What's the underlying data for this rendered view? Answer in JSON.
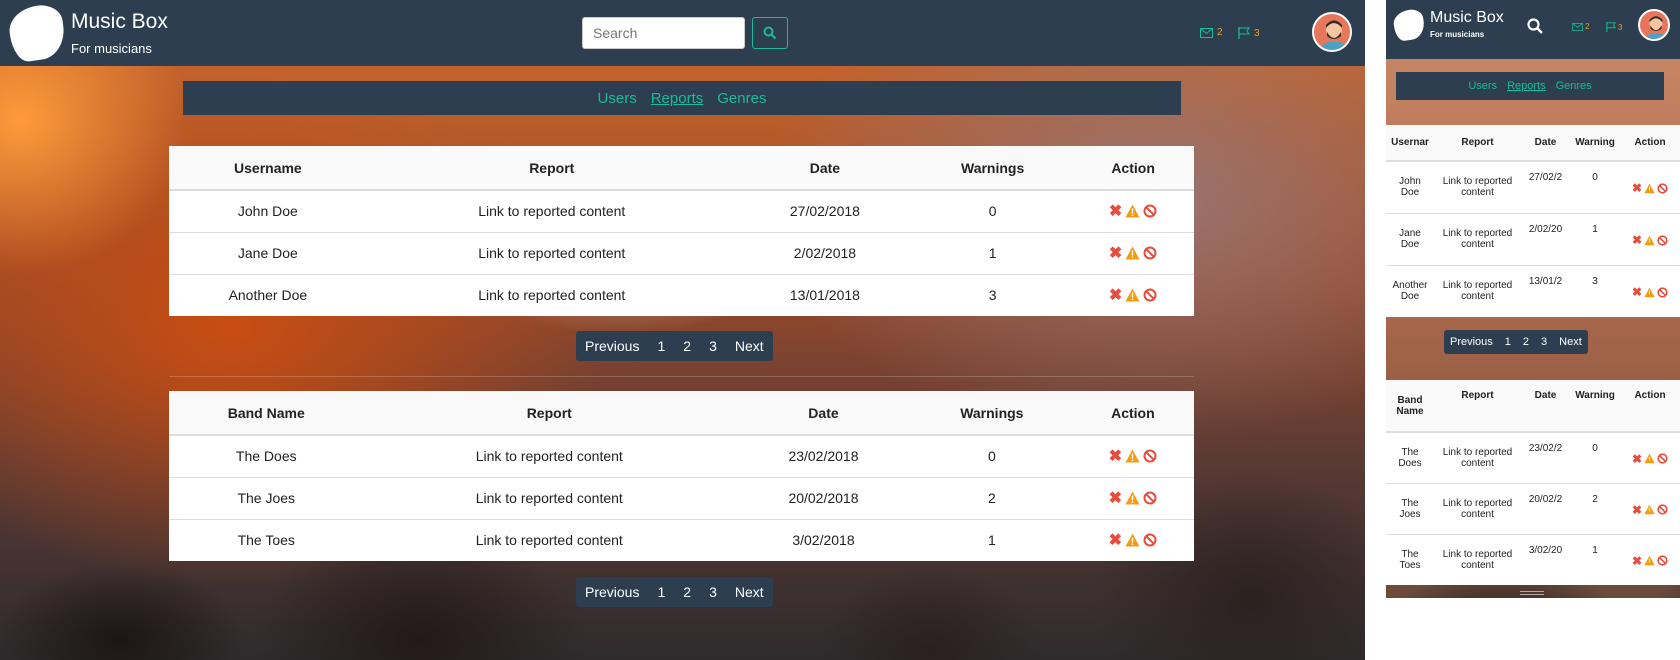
{
  "app": {
    "title": "Music Box",
    "subtitle": "For musicians"
  },
  "header": {
    "search_placeholder": "Search",
    "messages_count": "2",
    "flags_count": "3"
  },
  "subnav": {
    "items": [
      "Users",
      "Reports",
      "Genres"
    ],
    "active": "Reports"
  },
  "user_reports": {
    "headers": [
      "Username",
      "Report",
      "Date",
      "Warnings",
      "Action"
    ],
    "mobile_headers": [
      "Usernar",
      "Report",
      "Date",
      "Warning",
      "Action"
    ],
    "rows": [
      {
        "name": "John Doe",
        "report": "Link to reported content",
        "date": "27/02/2018",
        "mobile_date": "27/02/2",
        "warnings": "0"
      },
      {
        "name": "Jane Doe",
        "report": "Link to reported content",
        "date": "2/02/2018",
        "mobile_date": "2/02/20",
        "warnings": "1"
      },
      {
        "name": "Another Doe",
        "report": "Link to reported content",
        "date": "13/01/2018",
        "mobile_date": "13/01/2",
        "warnings": "3"
      }
    ]
  },
  "band_reports": {
    "headers": [
      "Band Name",
      "Report",
      "Date",
      "Warnings",
      "Action"
    ],
    "mobile_headers": [
      "Band Name",
      "Report",
      "Date",
      "Warning",
      "Action"
    ],
    "rows": [
      {
        "name": "The Does",
        "report": "Link to reported content",
        "date": "23/02/2018",
        "mobile_date": "23/02/2",
        "warnings": "0"
      },
      {
        "name": "The Joes",
        "report": "Link to reported content",
        "date": "20/02/2018",
        "mobile_date": "20/02/2",
        "warnings": "2"
      },
      {
        "name": "The Toes",
        "report": "Link to reported content",
        "date": "3/02/2018",
        "mobile_date": "3/02/20",
        "warnings": "1"
      }
    ]
  },
  "pagination": {
    "previous": "Previous",
    "pages": [
      "1",
      "2",
      "3"
    ],
    "next": "Next"
  },
  "colors": {
    "navbar": "#2c3e50",
    "accent": "#18bc9c",
    "warning": "#f39c12",
    "danger": "#e74c3c"
  }
}
